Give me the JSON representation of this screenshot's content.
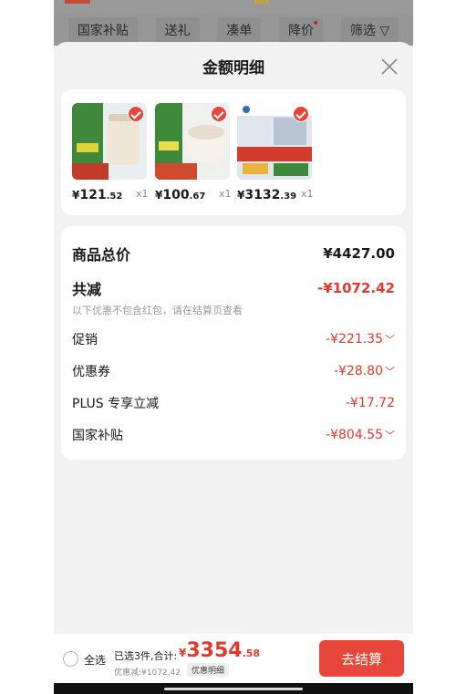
{
  "filters": [
    "国家补贴",
    "送礼",
    "凑单",
    "降价",
    "筛选 ▽"
  ],
  "sheet": {
    "title": "金额明细",
    "close_icon": "close-icon"
  },
  "products": [
    {
      "yen": "¥",
      "int": "121",
      "dec": ".52",
      "qty": "x1",
      "thumb_colors": [
        "#4f8c3c",
        "#efe6d6",
        "#c23a2a"
      ]
    },
    {
      "yen": "¥",
      "int": "100",
      "dec": ".67",
      "qty": "x1",
      "thumb_colors": [
        "#3f8a3a",
        "#f1ece2",
        "#d04a2f"
      ]
    },
    {
      "yen": "¥",
      "int": "3132",
      "dec": ".39",
      "qty": "x1",
      "thumb_colors": [
        "#2f6fb3",
        "#d8dfe8",
        "#d33a2a"
      ]
    }
  ],
  "summary": {
    "total_label": "商品总价",
    "total_value": "¥4427.00",
    "discount_label": "共减",
    "discount_value": "-¥1072.42",
    "note": "以下优惠不包含红包，请在结算页查看",
    "rows": [
      {
        "label": "促销",
        "value": "-¥221.35",
        "chevron": "﹀"
      },
      {
        "label": "优惠券",
        "value": "-¥28.80",
        "chevron": "﹀"
      },
      {
        "label": "PLUS 专享立减",
        "value": "-¥17.72",
        "chevron": ""
      },
      {
        "label": "国家补贴",
        "value": "-¥804.55",
        "chevron": "﹀"
      }
    ]
  },
  "footer": {
    "select_all": "全选",
    "count_text": "已选3件,合计:",
    "grand_yen": "¥",
    "grand_int": "3354",
    "grand_dec": ".58",
    "saved_text": "优惠减:¥1072.42",
    "detail_chip": "优惠明细",
    "checkout": "去结算"
  },
  "colors": {
    "accent": "#e0392d",
    "button": "#e8463a"
  }
}
